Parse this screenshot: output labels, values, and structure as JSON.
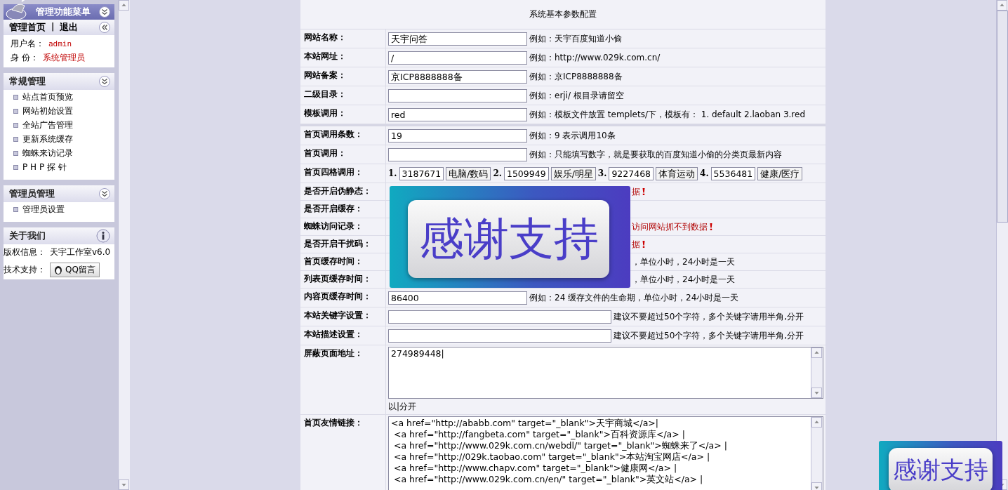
{
  "sidebar": {
    "menu_title": "管理功能菜单",
    "user_panel": {
      "links": [
        "管理首页",
        "退出"
      ],
      "separator": "|",
      "fields": [
        {
          "label": "用户名：",
          "value": "admin"
        },
        {
          "label": "身 份：",
          "value": "系统管理员"
        }
      ]
    },
    "sections": [
      {
        "title": "常规管理",
        "items": [
          "站点首页预览",
          "网站初始设置",
          "全站广告管理",
          "更新系统缓存",
          "蜘蛛来访记录",
          "P H P 探 针"
        ]
      },
      {
        "title": "管理员管理",
        "items": [
          "管理员设置"
        ]
      }
    ],
    "about": {
      "title": "关于我们",
      "copyright_label": "版权信息：",
      "copyright_value": "天宇工作室v6.0",
      "support_label": "技术支持：",
      "support_button": "QQ留言"
    }
  },
  "form": {
    "title": "系统基本参数配置",
    "groups": [
      [
        {
          "kind": "text",
          "label": "网站名称：",
          "value": "天宇问答",
          "hint": "例如：天宇百度知道小偷"
        },
        {
          "kind": "text",
          "label": "本站网址：",
          "value": "/",
          "hint": "例如：http://www.029k.com.cn/"
        },
        {
          "kind": "text",
          "label": "网站备案：",
          "value": "京ICP8888888备",
          "hint": "例如：京ICP8888888备"
        },
        {
          "kind": "text",
          "label": "二级目录：",
          "hint": "例如：erji/ 根目录请留空"
        },
        {
          "kind": "text",
          "label": "模板调用：",
          "value": "red",
          "hint": "例如：模板文件放置  templets/下，模板有：  1. default 2.laoban 3.red"
        }
      ],
      [
        {
          "kind": "text",
          "label": "首页调用条数：",
          "value": "19",
          "hint": "例如：9 表示调用10条"
        },
        {
          "kind": "text",
          "label": "首页调用：",
          "hint": "例如：只能填写数字，就是要获取的百度知道小偷的分类页最新内容"
        },
        {
          "kind": "quad",
          "label": "首页四格调用：",
          "slots": [
            {
              "number": "1.",
              "id": "3187671",
              "name": "电脑/数码"
            },
            {
              "number": "2.",
              "id": "1509949",
              "name": "娱乐/明星"
            },
            {
              "number": "3.",
              "id": "9227468",
              "name": "体育运动"
            },
            {
              "number": "4.",
              "id": "5536481",
              "name": "健康/医疗"
            }
          ]
        },
        {
          "kind": "covered",
          "label": "是否开启伪静态：",
          "hint": "据",
          "alert": true
        },
        {
          "kind": "covered",
          "label": "是否开启缓存："
        },
        {
          "kind": "covered",
          "label": "蜘蛛访问记录：",
          "hint": "访问网站抓不到数据",
          "alert": true
        },
        {
          "kind": "covered",
          "label": "是否开启干扰码：",
          "hint": "据",
          "alert": true
        },
        {
          "kind": "covered",
          "label": "首页缓存时间：",
          "hint": "，单位小时，24小时是一天",
          "alert": false
        },
        {
          "kind": "covered",
          "label": "列表页缓存时间：",
          "hint": "，单位小时，24小时是一天",
          "alert": false
        },
        {
          "kind": "text",
          "label": "内容页缓存时间：",
          "value": "86400",
          "hint": "例如：24 缓存文件的生命期，单位小时，24小时是一天"
        },
        {
          "kind": "wide",
          "label": "本站关键字设置：",
          "hint": "建议不要超过50个字符，多个关键字请用半角,分开"
        },
        {
          "kind": "wide",
          "label": "本站描述设置：",
          "hint": "建议不要超过50个字符，多个关键字请用半角,分开"
        },
        {
          "kind": "area",
          "label": "屏蔽页面地址：",
          "lines": [
            "274989448|"
          ],
          "note": "以|分开"
        },
        {
          "kind": "area",
          "label": "首页友情链接：",
          "lines": [
            "<a href=\"http://ababb.com\" target=\"_blank\">天宇商城</a>|",
            " <a href=\"http://fangbeta.com\" target=\"_blank\">百科资源库</a> |",
            " <a href=\"http://www.029k.com.cn/webdl/\" target=\"_blank\">蜘蛛来了</a> |",
            " <a href=\"http://029k.taobao.com\" target=\"_blank\">本站淘宝网店</a> |",
            " <a href=\"http://www.chapv.com\" target=\"_blank\">健康网</a> |",
            " <a href=\"http://www.029k.com.cn/en/\" target=\"_blank\">英文站</a> |"
          ]
        }
      ]
    ]
  },
  "overlays": [
    {
      "text": "感谢支持"
    },
    {
      "text": "感谢支持"
    }
  ]
}
